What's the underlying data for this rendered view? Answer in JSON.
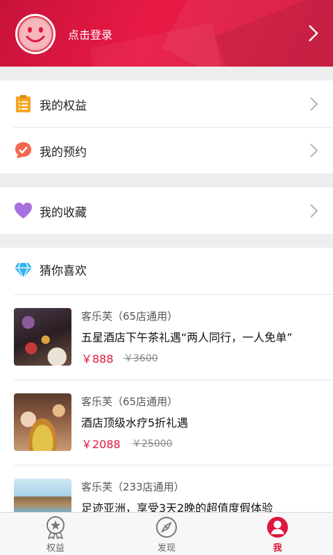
{
  "header": {
    "login_text": "点击登录"
  },
  "menu_group1": [
    {
      "label": "我的权益",
      "icon": "clipboard-icon"
    },
    {
      "label": "我的预约",
      "icon": "chat-check-icon"
    }
  ],
  "menu_group2": [
    {
      "label": "我的收藏",
      "icon": "heart-icon"
    }
  ],
  "guess": {
    "title": "猜你喜欢",
    "items": [
      {
        "brand": "客乐芙（65店通用）",
        "name": "五星酒店下午茶礼遇“两人同行，一人免单”",
        "price": "￥888",
        "orig": "￥3600"
      },
      {
        "brand": "客乐芙（65店通用）",
        "name": "酒店顶级水疗5折礼遇",
        "price": "￥2088",
        "orig": "￥25000"
      },
      {
        "brand": "客乐芙（233店通用）",
        "name": "足迹亚洲，享受3天2晚的超值度假体验",
        "price": "",
        "orig": ""
      }
    ]
  },
  "tabs": [
    {
      "label": "权益",
      "icon": "medal-icon"
    },
    {
      "label": "发现",
      "icon": "compass-icon"
    },
    {
      "label": "我",
      "icon": "profile-icon"
    }
  ],
  "colors": {
    "brand": "#e0163f",
    "header": "#d8173f"
  }
}
